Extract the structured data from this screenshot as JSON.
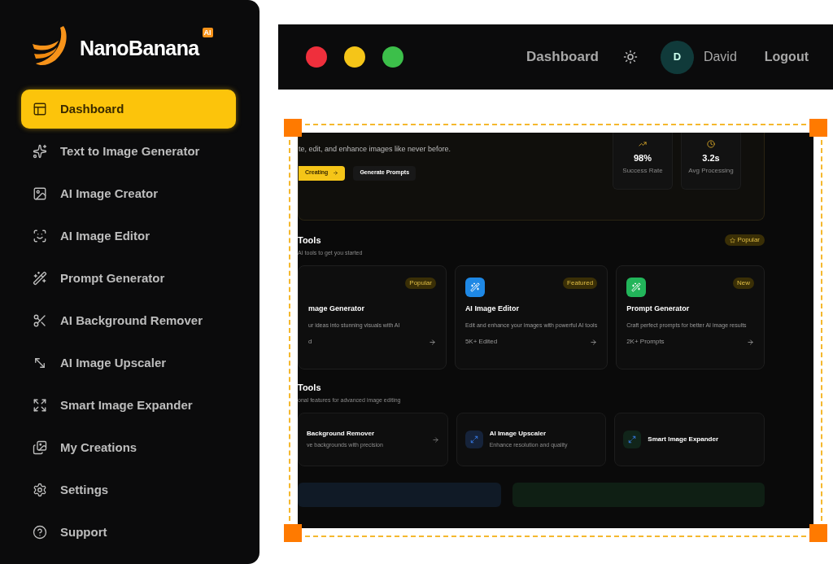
{
  "sidebar": {
    "logo": {
      "text": "NanoBanana",
      "badge": "AI"
    },
    "items": [
      {
        "label": "Dashboard",
        "selected": true
      },
      {
        "label": "Text to Image Generator",
        "selected": false
      },
      {
        "label": "AI Image Creator",
        "selected": false
      },
      {
        "label": "AI Image Editor",
        "selected": false
      },
      {
        "label": "Prompt Generator",
        "selected": false
      },
      {
        "label": "AI Background Remover",
        "selected": false
      },
      {
        "label": "AI Image Upscaler",
        "selected": false
      },
      {
        "label": "Smart Image Expander",
        "selected": false
      },
      {
        "label": "My Creations",
        "selected": false
      },
      {
        "label": "Settings",
        "selected": false
      },
      {
        "label": "Support",
        "selected": false
      }
    ]
  },
  "topbar": {
    "window_controls": [
      {
        "color": "#ef2f3c"
      },
      {
        "color": "#f5c518"
      },
      {
        "color": "#3cbf4a"
      }
    ],
    "nav": "Dashboard",
    "user": {
      "initial": "D",
      "name": "David"
    },
    "logout": "Logout"
  },
  "preview": {
    "hero": {
      "subtitle": "te, edit, and enhance images like never before.",
      "buttons": [
        {
          "label": "Creating",
          "kind": "primary"
        },
        {
          "label": "Generate Prompts",
          "kind": "secondary"
        }
      ],
      "stats": [
        {
          "value": "98%",
          "label": "Success Rate"
        },
        {
          "value": "3.2s",
          "label": "Avg Processing"
        }
      ]
    },
    "sections": [
      {
        "title": "Tools",
        "subtitle": "AI tools to get you started",
        "badge": "Popular",
        "cards": [
          {
            "badge": "Popular",
            "title": "mage Generator",
            "description": "ur ideas into stunning visuals with AI",
            "meta": "d"
          },
          {
            "badge": "Featured",
            "title": "AI Image Editor",
            "description": "Edit and enhance your images with powerful AI tools",
            "meta": "5K+ Edited",
            "color": "#1e88e5"
          },
          {
            "badge": "New",
            "title": "Prompt Generator",
            "description": "Craft perfect prompts for better AI image results",
            "meta": "2K+ Prompts",
            "color": "#22b55a"
          }
        ]
      },
      {
        "title": "Tools",
        "subtitle": "onal features for advanced image editing",
        "cards": [
          {
            "title": "Background Remover",
            "description": "ve backgrounds with precision"
          },
          {
            "title": "AI Image Upscaler",
            "description": "Enhance resolution and quality",
            "color": "#16233a"
          },
          {
            "title": "Smart Image Expander",
            "color": "#11251a"
          }
        ]
      }
    ]
  }
}
